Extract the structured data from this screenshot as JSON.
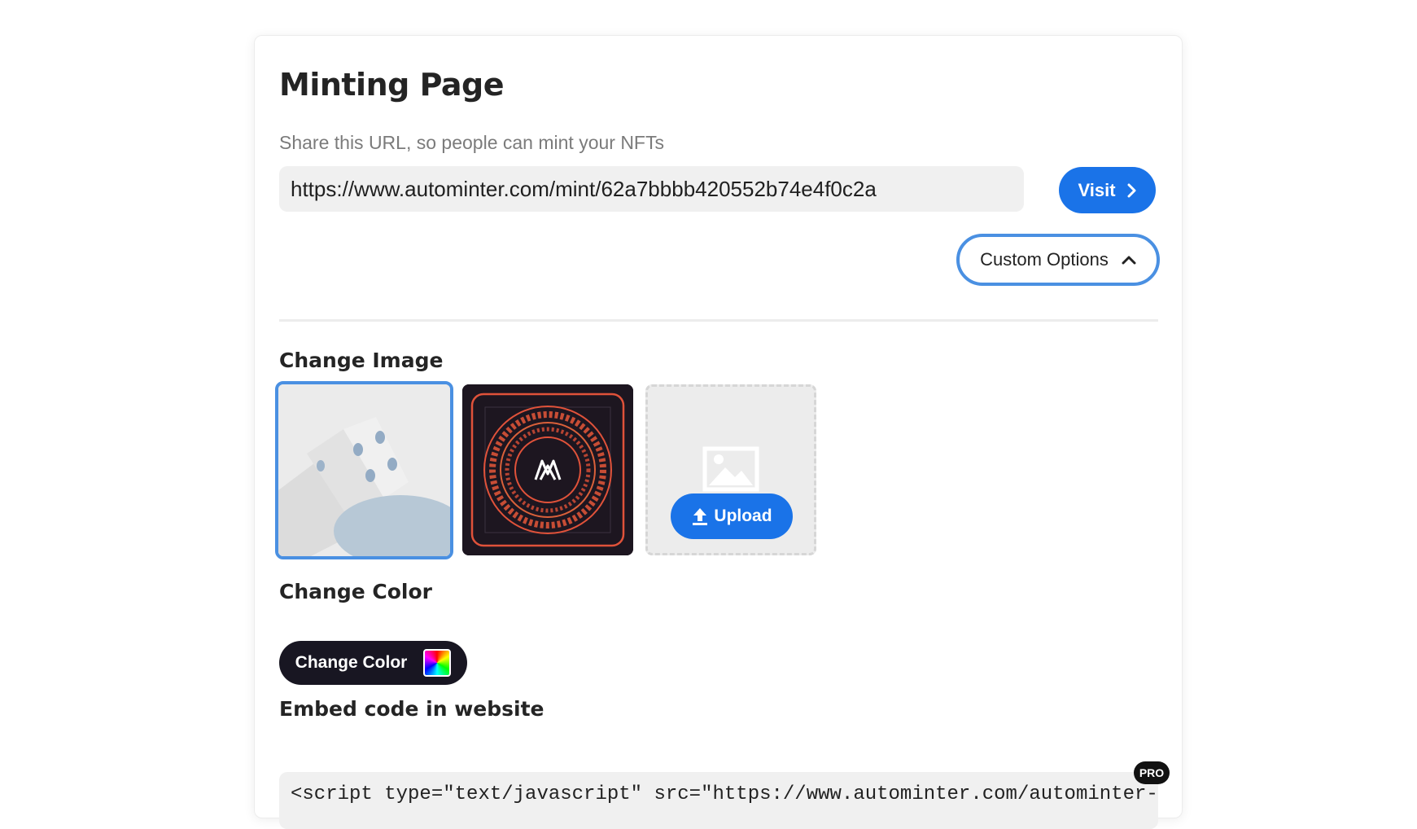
{
  "header": {
    "title": "Minting Page"
  },
  "share": {
    "label": "Share this URL, so people can mint your NFTs",
    "url": "https://www.autominter.com/mint/62a7bbbb420552b74e4f0c2a",
    "visit_label": "Visit"
  },
  "custom_options": {
    "label": "Custom Options",
    "expanded": true
  },
  "image_section": {
    "label": "Change Image",
    "upload_label": "Upload",
    "selected_index": 0
  },
  "color_section": {
    "label": "Change Color",
    "button_label": "Change Color"
  },
  "embed_section": {
    "label": "Embed code in website",
    "code": "<script type=\"text/javascript\" src=\"https://www.autominter.com/autominter-widget.js\">",
    "badge": "PRO"
  },
  "colors": {
    "accent": "#1a73e8",
    "focus_border": "#4a90e2",
    "dark_button": "#181622"
  }
}
